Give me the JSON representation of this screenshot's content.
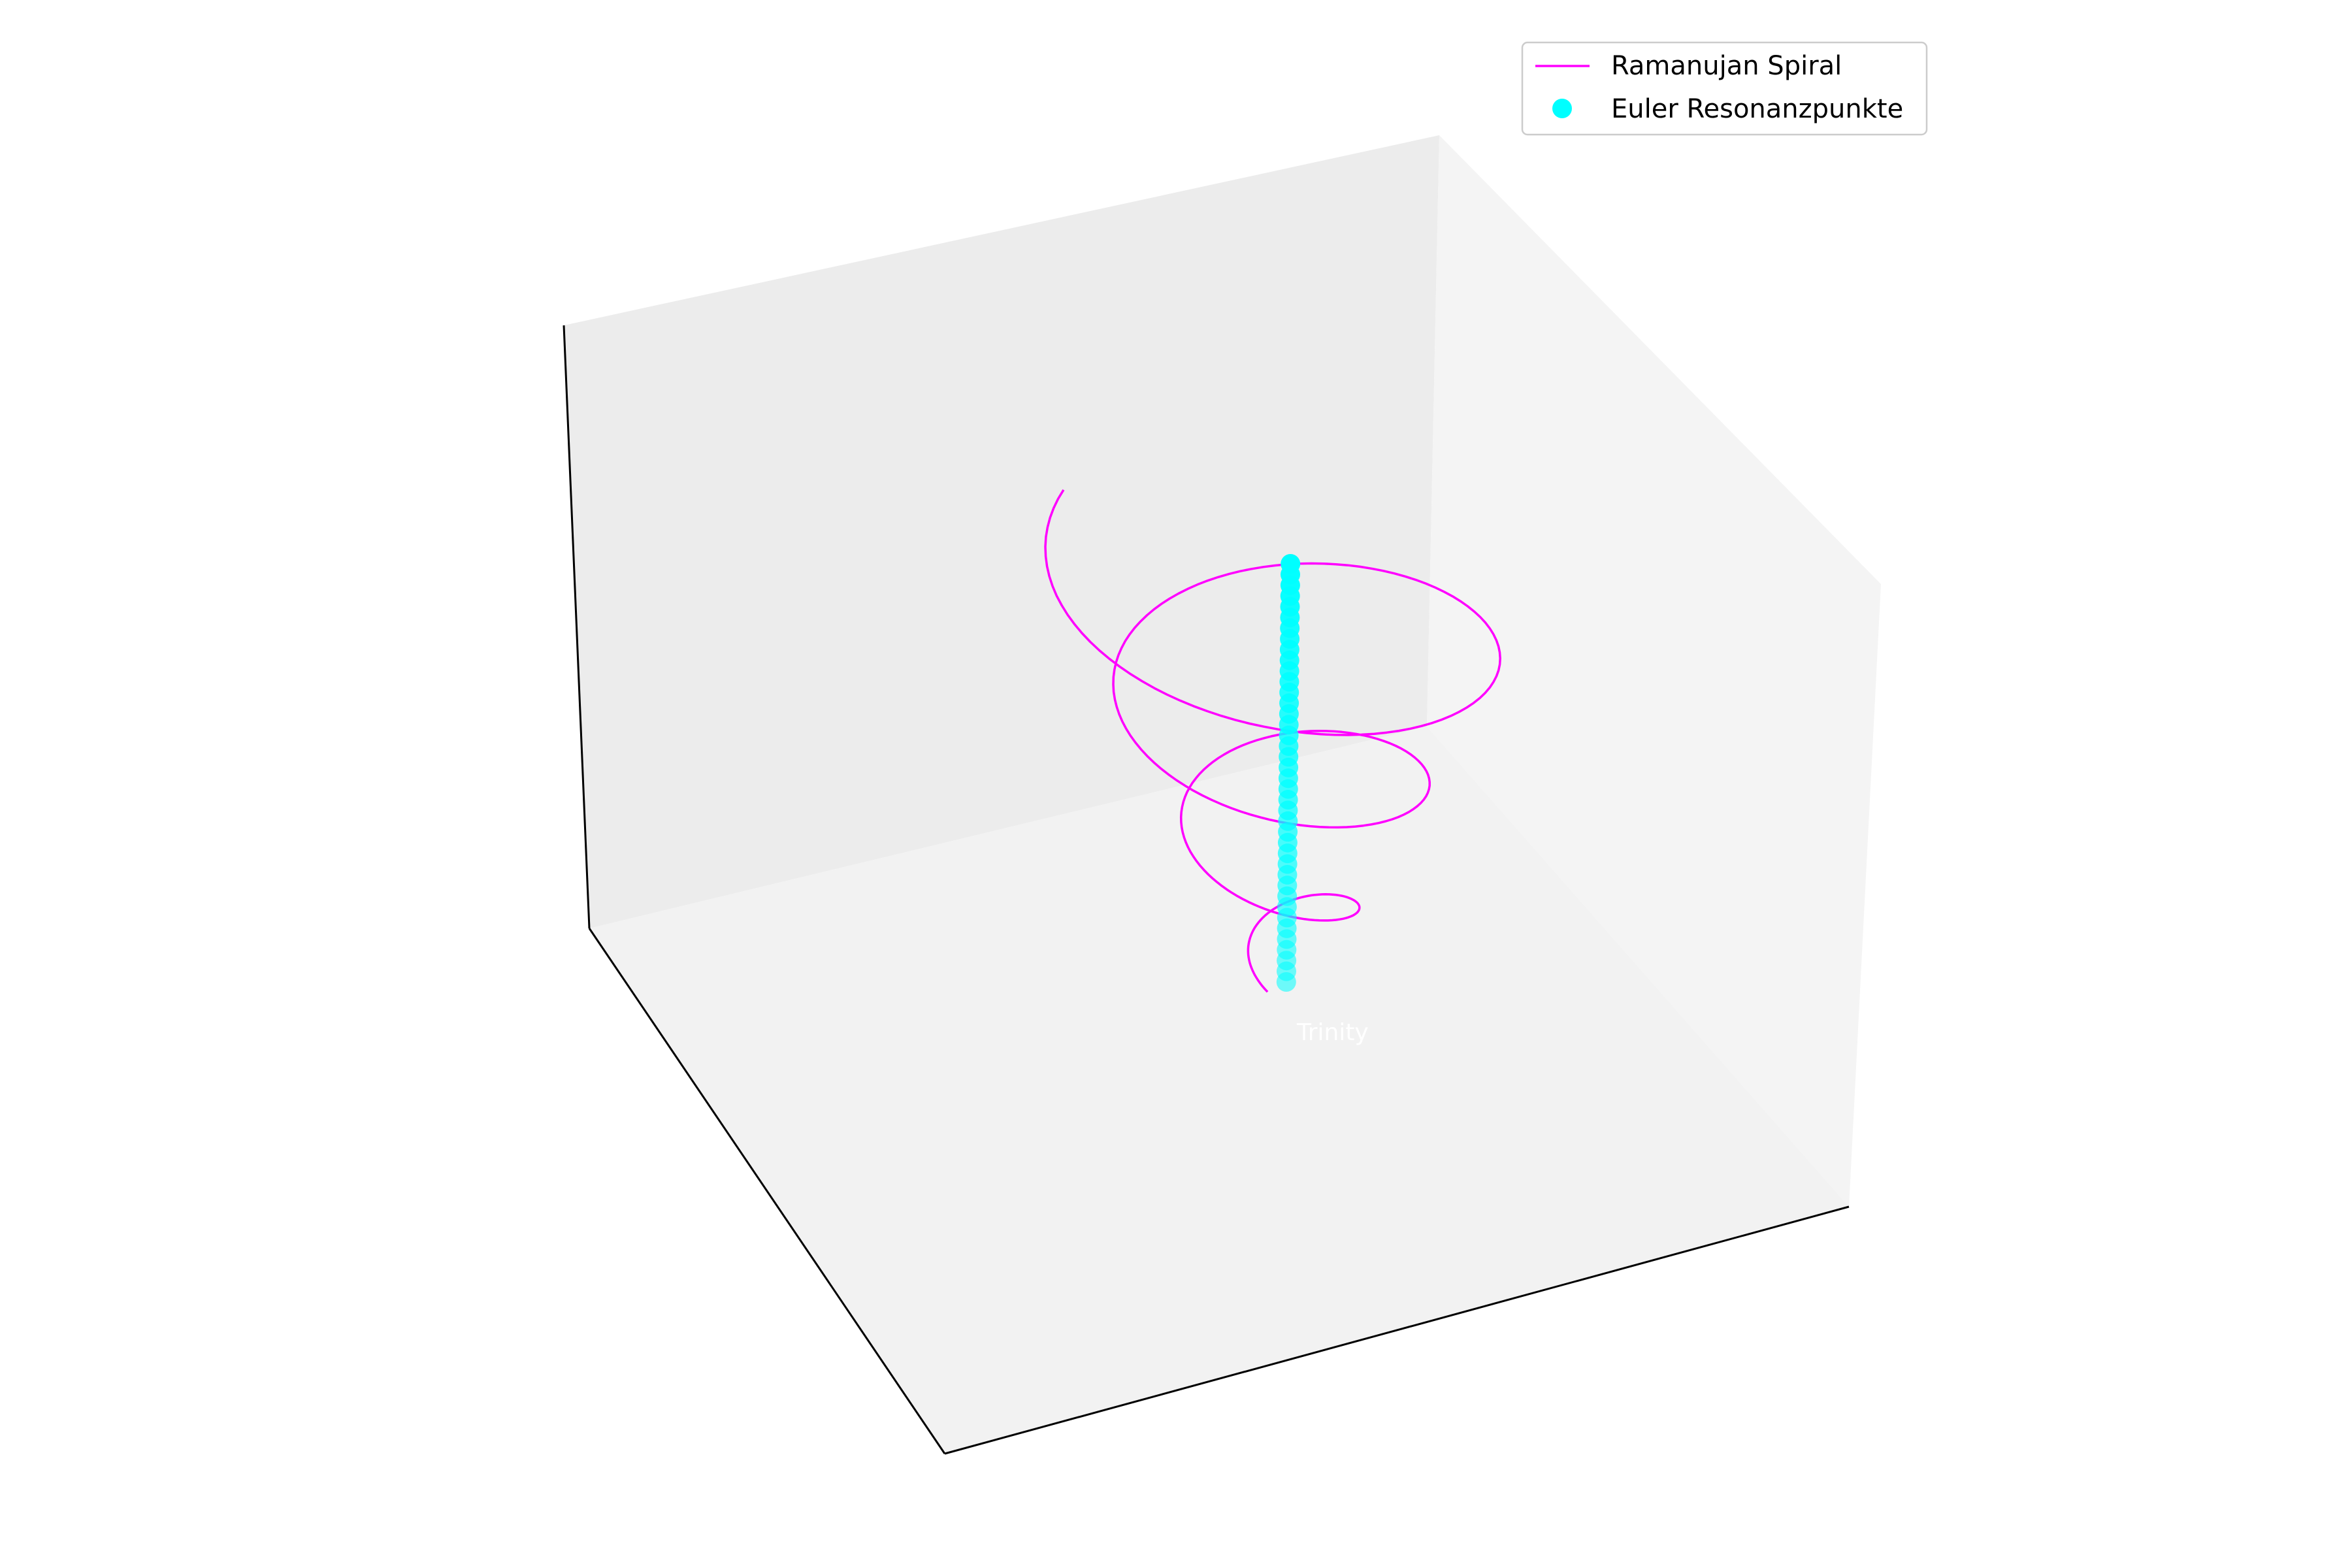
{
  "chart_data": {
    "type": "line",
    "projection": "3d",
    "title": "",
    "xlabel": "",
    "ylabel": "",
    "zlabel": "",
    "axes_visible": false,
    "grid": false,
    "legend_position": "top-right",
    "series": [
      {
        "name": "Ramanujan Spiral",
        "kind": "line",
        "color": "#ff00ff",
        "equation": "r = t, theta = 2*pi*t, z = t",
        "t_range": [
          0.4,
          3.6
        ],
        "points_sampled": 320
      },
      {
        "name": "Euler Resonanzpunkte",
        "kind": "scatter",
        "color": "#00ffff",
        "x_value": 0,
        "y_value": 0,
        "point_count": 40,
        "z_range": [
          0.4,
          3.6
        ]
      }
    ],
    "annotations": [
      {
        "text": "Trinity",
        "color": "#ffffff"
      }
    ]
  },
  "colors": {
    "pane_left": "#ececec",
    "pane_right": "#f4f4f4",
    "pane_floor": "#f2f2f2",
    "axis_line": "#000000"
  },
  "legend": {
    "entries": [
      {
        "label": "Ramanujan Spiral",
        "marker": "line",
        "color": "#ff00ff"
      },
      {
        "label": "Euler Resonanzpunkte",
        "marker": "dot",
        "color": "#00ffff"
      }
    ]
  }
}
